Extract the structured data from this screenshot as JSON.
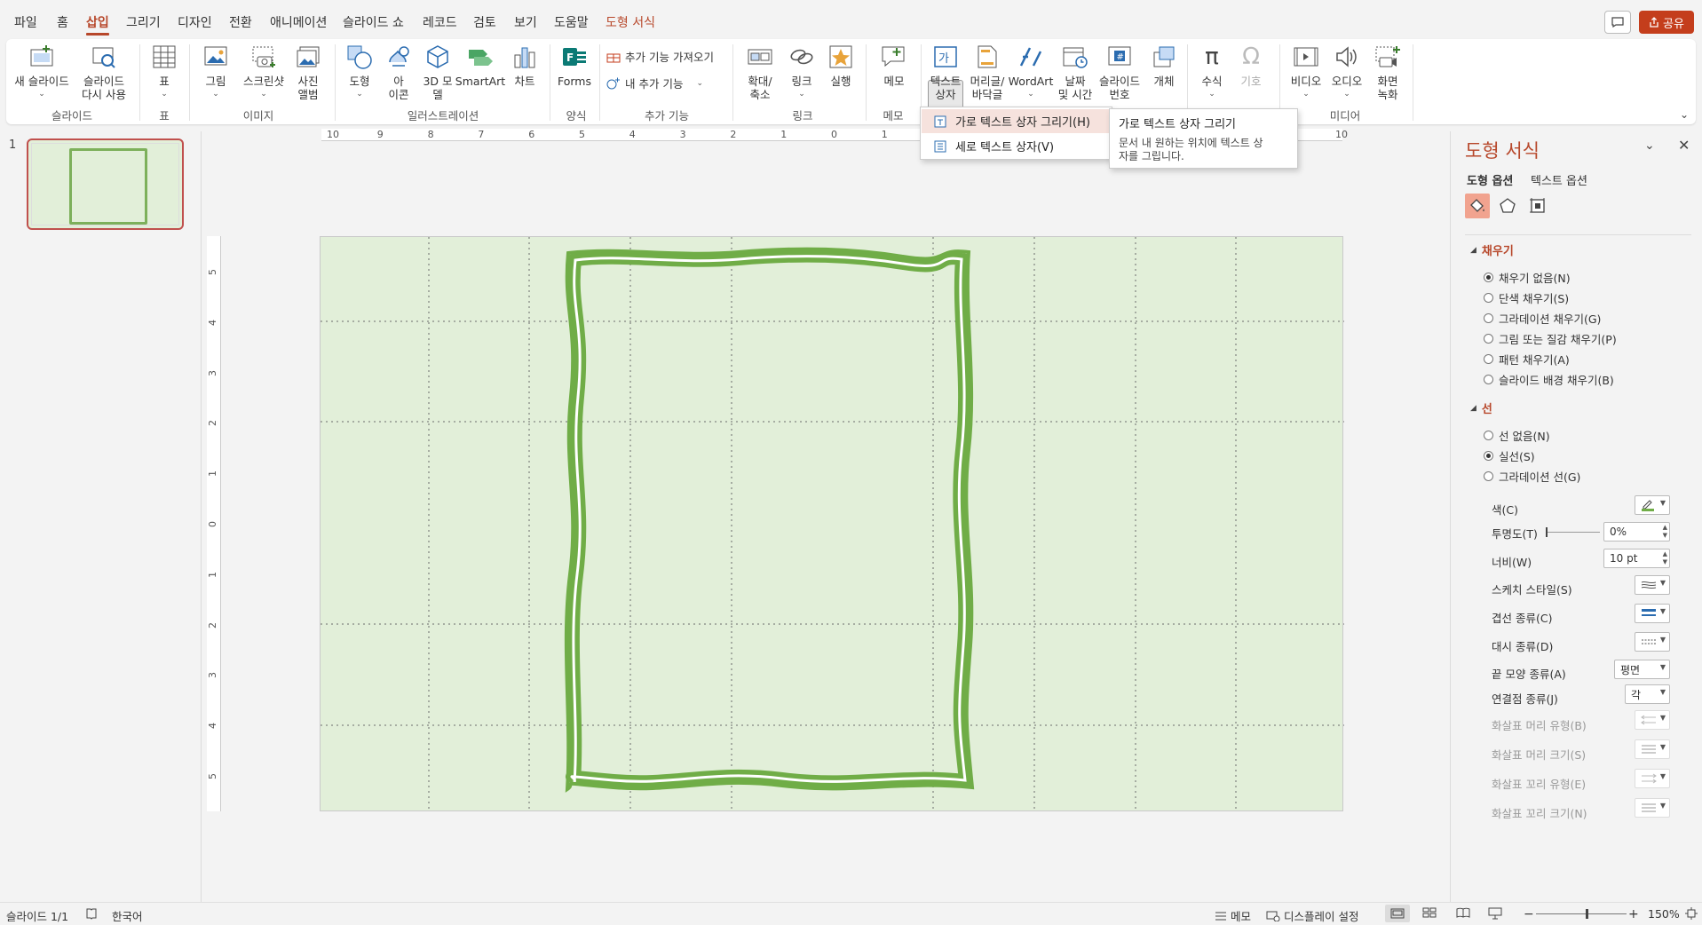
{
  "menu": {
    "tabs": [
      "파일",
      "홈",
      "삽입",
      "그리기",
      "디자인",
      "전환",
      "애니메이션",
      "슬라이드 쇼",
      "레코드",
      "검토",
      "보기",
      "도움말",
      "도형 서식"
    ],
    "active_tab": "삽입",
    "contextual_tab": "도형 서식",
    "share_label": "공유"
  },
  "ribbon": {
    "new_slide": "새 슬라이드",
    "reuse_slide": "슬라이드\n다시 사용",
    "table": "표",
    "picture": "그림",
    "screenshot": "스크린샷",
    "photo_album": "사진\n앨범",
    "shapes": "도형",
    "icons": "아\n이콘",
    "models_3d": "3D 모\n델",
    "smartart": "SmartArt",
    "chart": "차트",
    "forms": "Forms",
    "get_addins": "추가 기능 가져오기",
    "my_addins": "내 추가 기능",
    "zoom": "확대/\n축소",
    "link": "링크",
    "action": "실행",
    "comment": "메모",
    "text_box": "텍스트\n상자",
    "header_footer": "머리글/\n바닥글",
    "wordart": "WordArt",
    "date_time": "날짜\n및 시간",
    "slide_number": "슬라이드\n번호",
    "object": "개체",
    "equation": "수식",
    "symbol": "기호",
    "video": "비디오",
    "audio": "오디오",
    "screen_recording": "화면\n녹화",
    "groups": {
      "slides": "슬라이드",
      "tables": "표",
      "images": "이미지",
      "illustrations": "일러스트레이션",
      "forms": "양식",
      "addins": "추가 기능",
      "links": "링크",
      "comments": "메모",
      "media": "미디어"
    }
  },
  "textbox_menu": {
    "horizontal": "가로 텍스트 상자 그리기(H)",
    "vertical": "세로 텍스트 상자(V)"
  },
  "tooltip": {
    "title": "가로 텍스트 상자 그리기",
    "body": "문서 내 원하는 위치에 텍스트 상자를 그립니다."
  },
  "thumbnails": {
    "slide_number": "1"
  },
  "rulers": {
    "horizontal": [
      "10",
      "9",
      "8",
      "7",
      "6",
      "5",
      "4",
      "3",
      "2",
      "1",
      "0",
      "1",
      "2",
      "3",
      "4",
      "5",
      "6",
      "7",
      "8",
      "9",
      "10"
    ],
    "vertical": [
      "5",
      "4",
      "3",
      "2",
      "1",
      "0",
      "1",
      "2",
      "3",
      "4",
      "5"
    ]
  },
  "format_pane": {
    "title": "도형 서식",
    "tab_shape": "도형 옵션",
    "tab_text": "텍스트 옵션",
    "fill_header": "채우기",
    "fill_options": [
      {
        "label": "채우기 없음(N)",
        "selected": true
      },
      {
        "label": "단색 채우기(S)",
        "selected": false
      },
      {
        "label": "그라데이션 채우기(G)",
        "selected": false
      },
      {
        "label": "그림 또는 질감 채우기(P)",
        "selected": false
      },
      {
        "label": "패턴 채우기(A)",
        "selected": false
      },
      {
        "label": "슬라이드 배경 채우기(B)",
        "selected": false
      }
    ],
    "line_header": "선",
    "line_options": [
      {
        "label": "선 없음(N)",
        "selected": false
      },
      {
        "label": "실선(S)",
        "selected": true
      },
      {
        "label": "그라데이션 선(G)",
        "selected": false
      }
    ],
    "props": {
      "color": "색(C)",
      "transparency": "투명도(T)",
      "transparency_value": "0%",
      "width": "너비(W)",
      "width_value": "10 pt",
      "sketch_style": "스케치 스타일(S)",
      "compound_type": "겹선 종류(C)",
      "dash_type": "대시 종류(D)",
      "cap_type": "끝 모양 종류(A)",
      "cap_value": "평면",
      "join_type": "연결점 종류(J)",
      "join_value": "각",
      "arrow_begin_type": "화살표 머리 유형(B)",
      "arrow_begin_size": "화살표 머리 크기(S)",
      "arrow_end_type": "화살표 꼬리 유형(E)",
      "arrow_end_size": "화살표 꼬리 크기(N)"
    }
  },
  "statusbar": {
    "slide_info": "슬라이드 1/1",
    "language": "한국어",
    "notes": "메모",
    "display_settings": "디스플레이 설정",
    "zoom": "150%"
  },
  "colors": {
    "accent": "#b7472a",
    "share": "#c43e1c",
    "slide_bg": "#e2efd9",
    "frame_green": "#70ad47"
  }
}
